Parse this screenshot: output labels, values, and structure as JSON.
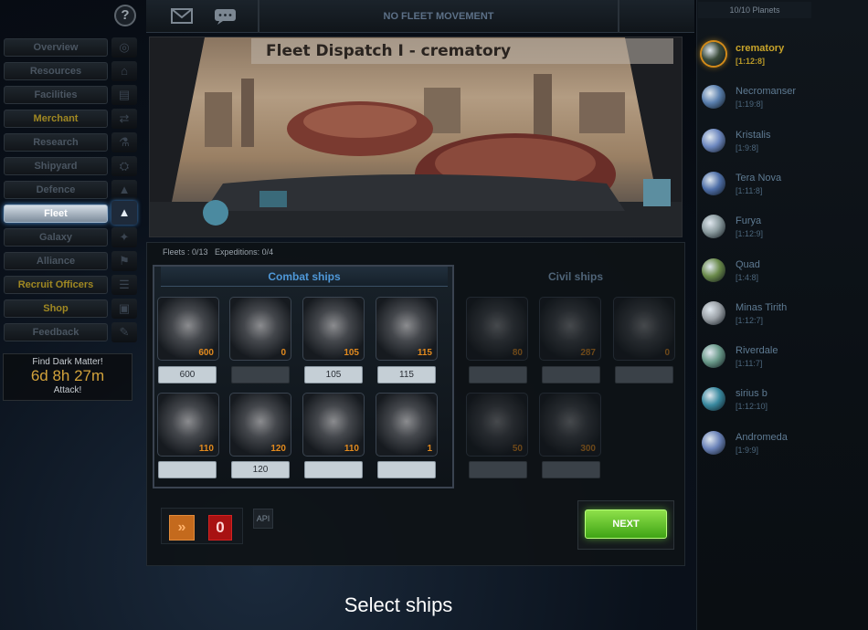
{
  "nav": {
    "items": [
      {
        "label": "Overview",
        "active": false
      },
      {
        "label": "Resources",
        "active": false
      },
      {
        "label": "Facilities",
        "active": false
      },
      {
        "label": "Merchant",
        "active": false
      },
      {
        "label": "Research",
        "active": false
      },
      {
        "label": "Shipyard",
        "active": false
      },
      {
        "label": "Defence",
        "active": false
      },
      {
        "label": "Fleet",
        "active": true
      },
      {
        "label": "Galaxy",
        "active": false
      },
      {
        "label": "Alliance",
        "active": false
      },
      {
        "label": "Recruit Officers",
        "active": false
      },
      {
        "label": "Shop",
        "active": false
      },
      {
        "label": "Feedback",
        "active": false
      }
    ]
  },
  "dark_matter": {
    "title": "Find Dark Matter!",
    "timer": "6d 8h 27m",
    "action": "Attack!"
  },
  "topbar": {
    "fleet_movement": "NO FLEET MOVEMENT"
  },
  "banner": {
    "title": "Fleet Dispatch I - crematory"
  },
  "stats": {
    "fleets": "Fleets : 0/13",
    "expeditions": "Expeditions: 0/4"
  },
  "tabs": {
    "combat": "Combat ships",
    "civil": "Civil ships"
  },
  "combat_ships": [
    {
      "count": "600",
      "input": "600"
    },
    {
      "count": "0",
      "input": ""
    },
    {
      "count": "105",
      "input": "105"
    },
    {
      "count": "115",
      "input": "115"
    },
    {
      "count": "110",
      "input": ""
    },
    {
      "count": "120",
      "input": "120"
    },
    {
      "count": "110",
      "input": ""
    },
    {
      "count": "1",
      "input": ""
    }
  ],
  "civil_ships": [
    {
      "count": "80",
      "input": ""
    },
    {
      "count": "287",
      "input": ""
    },
    {
      "count": "0",
      "input": ""
    },
    {
      "count": "50",
      "input": ""
    },
    {
      "count": "300",
      "input": ""
    }
  ],
  "controls": {
    "all_label": "»",
    "clear_label": "0",
    "api_label": "API",
    "next_label": "NEXT"
  },
  "caption": "Select ships",
  "planets": {
    "count": "10/10 Planets",
    "list": [
      {
        "name": "crematory",
        "coords": "[1:12:8]",
        "current": true,
        "color": "#3a4a3a"
      },
      {
        "name": "Necromanser",
        "coords": "[1:19:8]",
        "current": false,
        "color": "#5a7fae"
      },
      {
        "name": "Kristalis",
        "coords": "[1:9:8]",
        "current": false,
        "color": "#6d88c0"
      },
      {
        "name": "Tera Nova",
        "coords": "[1:11:8]",
        "current": false,
        "color": "#4f6fa8"
      },
      {
        "name": "Furya",
        "coords": "[1:12:9]",
        "current": false,
        "color": "#8a9a9e"
      },
      {
        "name": "Quad",
        "coords": "[1:4:8]",
        "current": false,
        "color": "#6a8a4a"
      },
      {
        "name": "Minas Tirith",
        "coords": "[1:12:7]",
        "current": false,
        "color": "#9aa0a6"
      },
      {
        "name": "Riverdale",
        "coords": "[1:11:7]",
        "current": false,
        "color": "#6a9a8a"
      },
      {
        "name": "sirius b",
        "coords": "[1:12:10]",
        "current": false,
        "color": "#3a8aa0"
      },
      {
        "name": "Andromeda",
        "coords": "[1:9:9]",
        "current": false,
        "color": "#6a82b8"
      }
    ]
  }
}
